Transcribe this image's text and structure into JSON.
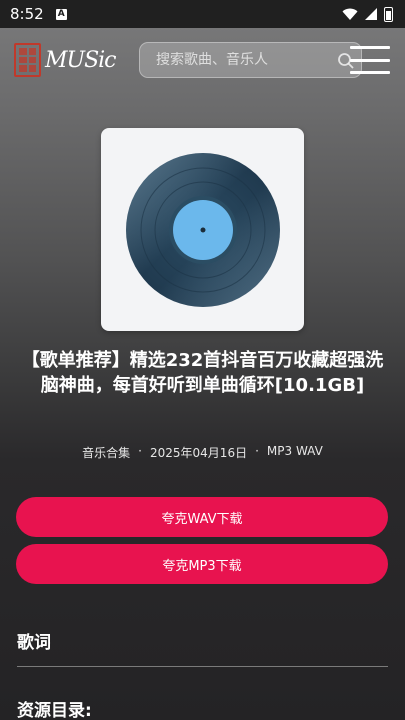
{
  "status_bar": {
    "time": "8:52",
    "notification_icon": "A",
    "icons": [
      "wifi-icon",
      "signal-icon",
      "battery-icon"
    ]
  },
  "header": {
    "logo_text": "MUSic",
    "search_placeholder": "搜索歌曲、音乐人",
    "menu_icon": "menu-icon"
  },
  "album": {
    "cover_icon": "vinyl-record-icon",
    "title": "【歌单推荐】精选232首抖音百万收藏超强洗脑神曲，每首好听到单曲循环[10.1GB]",
    "meta": {
      "category": "音乐合集",
      "date": "2025年04月16日",
      "formats": "MP3 WAV",
      "separator": "·"
    }
  },
  "buttons": {
    "wav_download": "夸克WAV下载",
    "mp3_download": "夸克MP3下载"
  },
  "sections": {
    "lyrics": "歌词",
    "resource_directory": "资源目录:"
  },
  "colors": {
    "accent": "#e8134f",
    "logo_red": "#c0392b",
    "vinyl_dark": "#2f4f66",
    "vinyl_label": "#6bb8ec"
  }
}
